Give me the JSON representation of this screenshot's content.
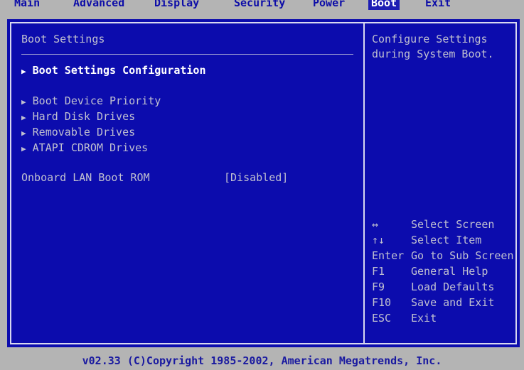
{
  "tabs": [
    {
      "label": "Main"
    },
    {
      "label": "Advanced"
    },
    {
      "label": "Display"
    },
    {
      "label": "Security"
    },
    {
      "label": "Power"
    },
    {
      "label": "Boot"
    },
    {
      "label": "Exit"
    }
  ],
  "active_tab": "Boot",
  "panel": {
    "title": "Boot Settings",
    "config_item": "Boot Settings Configuration",
    "submenu_items": [
      "Boot Device Priority",
      "Hard Disk Drives",
      "Removable Drives",
      "ATAPI CDROM Drives"
    ],
    "option_label": "Onboard LAN Boot ROM",
    "option_value": "[Disabled]"
  },
  "help": {
    "line1": "Configure Settings",
    "line2": "during System Boot."
  },
  "keys": [
    {
      "key": "↔",
      "desc": "Select Screen"
    },
    {
      "key": "↑↓",
      "desc": "Select Item"
    },
    {
      "key": "Enter",
      "desc": "Go to Sub Screen"
    },
    {
      "key": "F1",
      "desc": "General Help"
    },
    {
      "key": "F9",
      "desc": "Load Defaults"
    },
    {
      "key": "F10",
      "desc": "Save and Exit"
    },
    {
      "key": "ESC",
      "desc": "Exit"
    }
  ],
  "footer": "v02.33 (C)Copyright 1985-2002, American Megatrends, Inc.",
  "colors": {
    "background": "#0c0cad",
    "menu_bar": "#b4b4b4",
    "highlight_text": "#ffffff",
    "normal_text": "#c0c0d0"
  }
}
